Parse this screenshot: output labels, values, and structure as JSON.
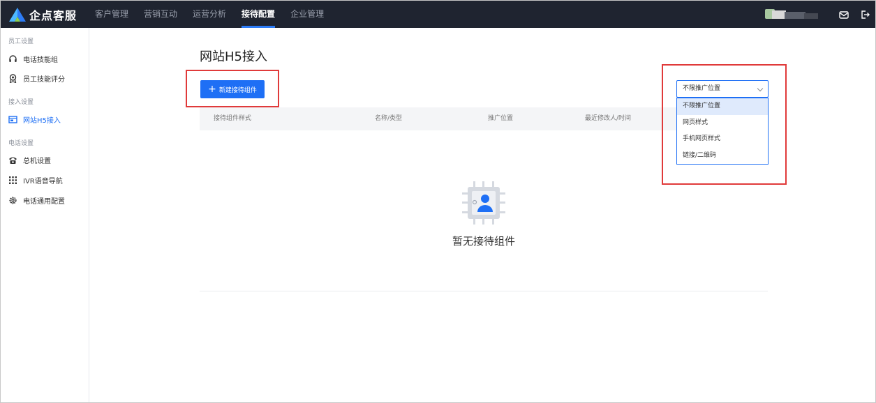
{
  "app": {
    "name": "企点客服"
  },
  "nav": {
    "items": [
      "客户管理",
      "营销互动",
      "运营分析",
      "接待配置",
      "企业管理"
    ],
    "active": "接待配置"
  },
  "sidebar": {
    "groups": [
      {
        "title": "员工设置",
        "items": [
          {
            "label": "电话技能组",
            "icon": "headset-icon"
          },
          {
            "label": "员工技能评分",
            "icon": "award-icon"
          }
        ]
      },
      {
        "title": "接入设置",
        "items": [
          {
            "label": "网站H5接入",
            "icon": "web-window-icon",
            "active": true
          }
        ]
      },
      {
        "title": "电话设置",
        "items": [
          {
            "label": "总机设置",
            "icon": "telephone-icon"
          },
          {
            "label": "IVR语音导航",
            "icon": "grid-dots-icon"
          },
          {
            "label": "电话通用配置",
            "icon": "gear-icon"
          }
        ]
      }
    ]
  },
  "main": {
    "title": "网站H5接入",
    "new_button": "新建接待组件",
    "columns": [
      "接待组件样式",
      "名称/类型",
      "推广位置",
      "最近修改人/时间"
    ],
    "empty_text": "暂无接待组件"
  },
  "filter": {
    "selected": "不限推广位置",
    "options": [
      "不限推广位置",
      "网页样式",
      "手机网页样式",
      "链接/二维码"
    ]
  },
  "colors": {
    "accent": "#1e6ff5",
    "topbar": "#1f2430",
    "highlight_box": "#e03a3a"
  }
}
